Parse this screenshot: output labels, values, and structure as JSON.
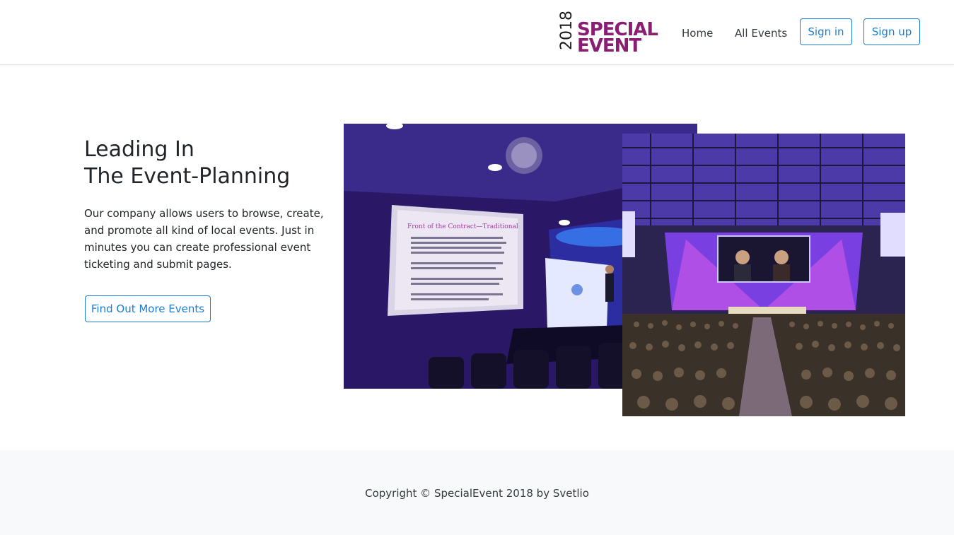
{
  "header": {
    "logo": {
      "year": "2018",
      "line1": "SPECIAL",
      "line2": "EVENT"
    },
    "nav": [
      {
        "label": "Home"
      },
      {
        "label": "All Events"
      }
    ],
    "sign_in_label": "Sign in",
    "sign_up_label": "Sign up"
  },
  "hero": {
    "title_line1": "Leading In",
    "title_line2": "The Event-Planning",
    "description": "Our company allows users to browse, create, and promote all kind of local events. Just in minutes you can create professional event ticketing and submit pages.",
    "cta_label": "Find Out More Events",
    "slide_title": "Front of the Contract—Traditional"
  },
  "footer": {
    "copyright": "Copyright © SpecialEvent 2018 by Svetlio"
  },
  "colors": {
    "brand": "#8a1e73",
    "accent": "#1b7cd8",
    "footer_bg": "#f8f9fa"
  }
}
